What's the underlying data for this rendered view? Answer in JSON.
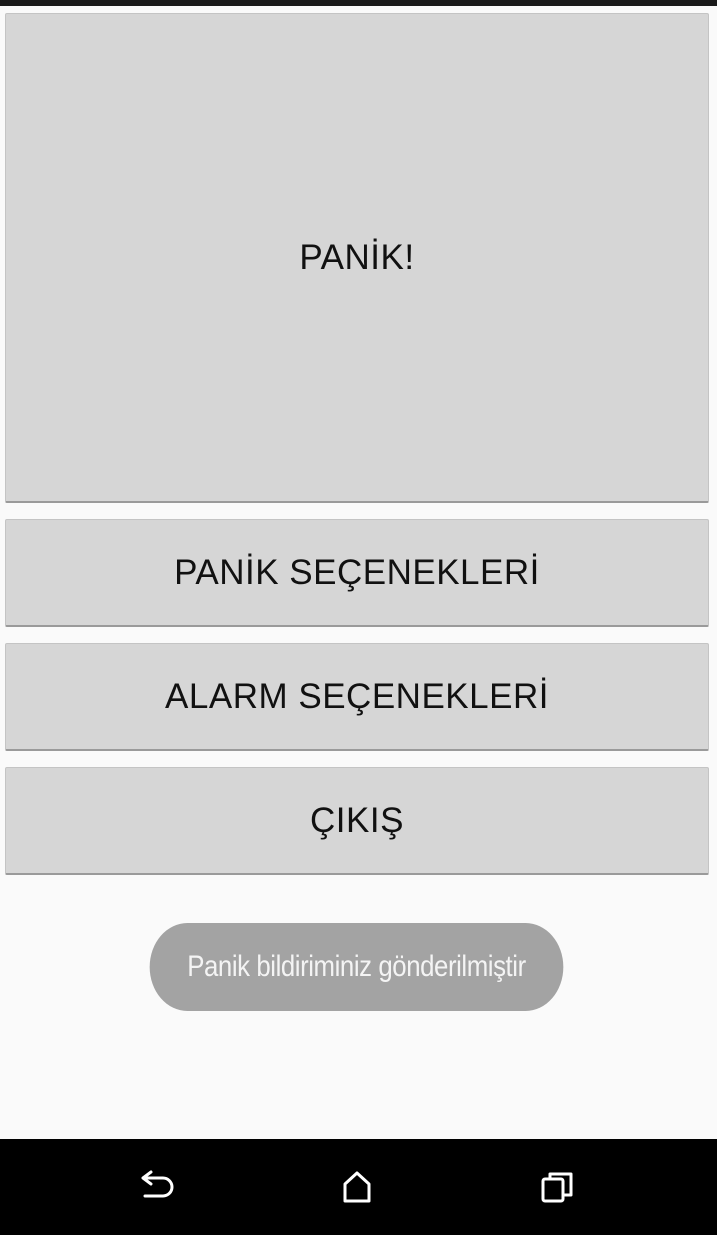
{
  "main": {
    "panic_button": "PANİK!",
    "panic_options_button": "PANİK SEÇENEKLERİ",
    "alarm_options_button": "ALARM SEÇENEKLERİ",
    "exit_button": "ÇIKIŞ"
  },
  "toast": {
    "message": "Panik bildiriminiz gönderilmiştir"
  },
  "nav_bar": {
    "icons": [
      "back-icon",
      "home-icon",
      "recents-icon"
    ]
  },
  "colors": {
    "button_bg": "#d6d6d6",
    "page_bg": "#fafafa",
    "toast_bg": "#a3a3a3",
    "nav_bg": "#000000"
  }
}
